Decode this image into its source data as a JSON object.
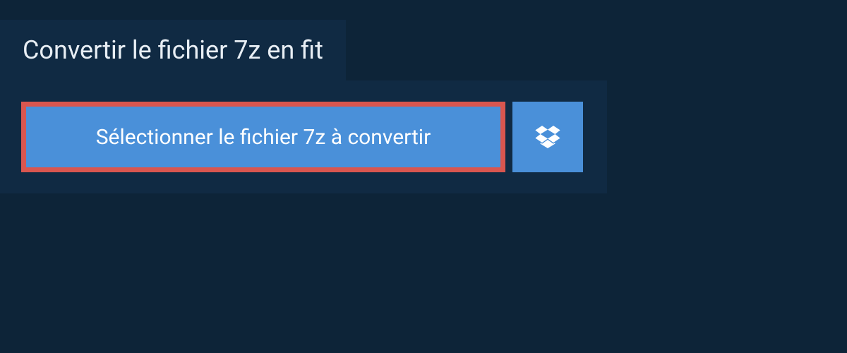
{
  "header": {
    "title": "Convertir le fichier 7z en fit"
  },
  "actions": {
    "select_file_label": "Sélectionner le fichier 7z à convertir"
  }
}
